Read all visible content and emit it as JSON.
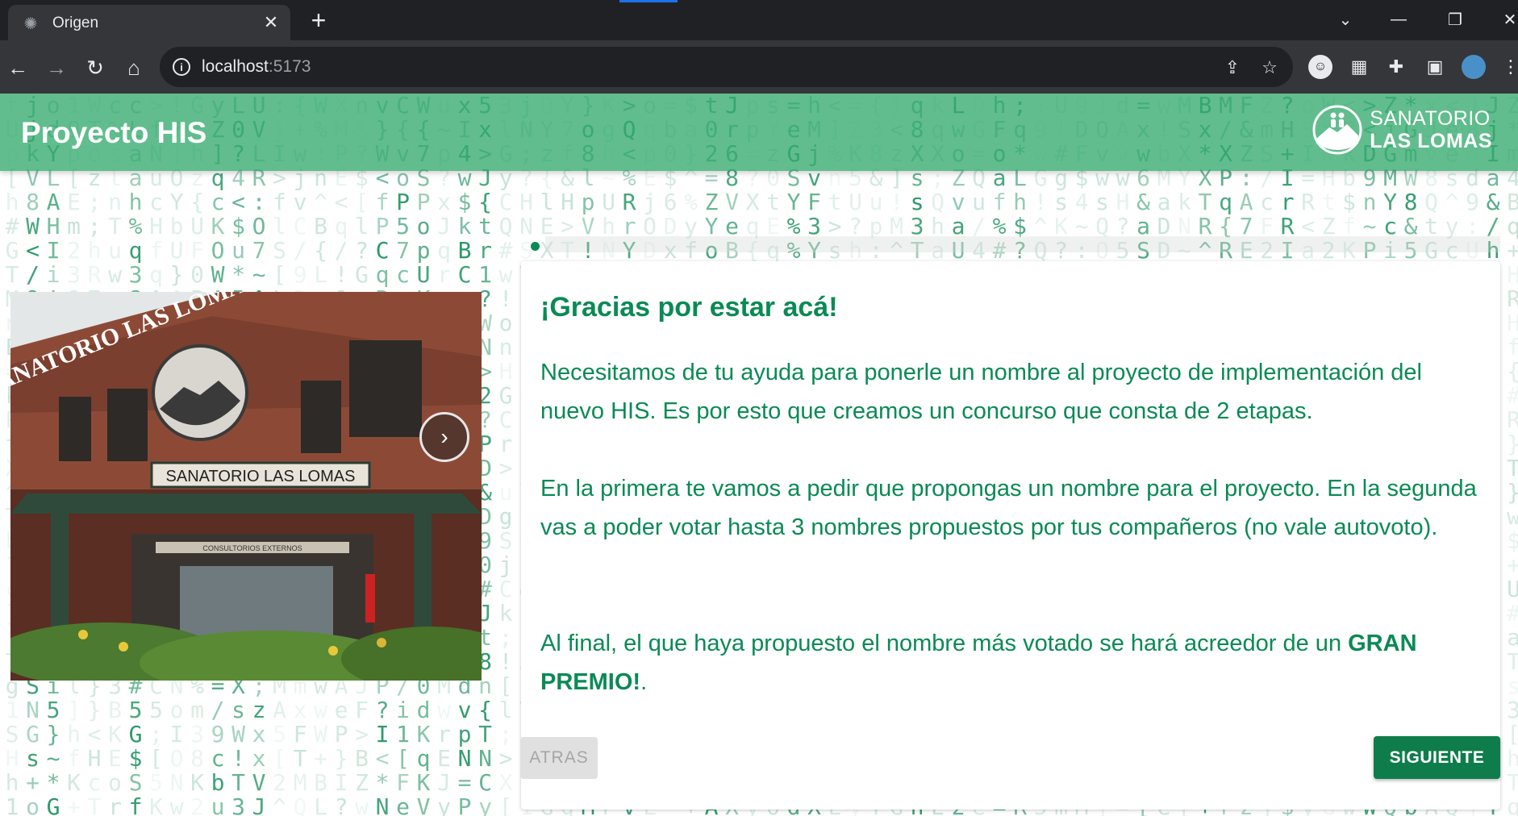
{
  "browser": {
    "tab_title": "Origen",
    "new_tab_label": "+",
    "url_host": "localhost",
    "url_port": ":5173"
  },
  "page": {
    "app_title": "Proyecto HIS",
    "brand": {
      "line1": "SANATORIO",
      "line2": "LAS LOMAS"
    },
    "card": {
      "title": "¡Gracias por estar acá!",
      "paragraph1": "Necesitamos de tu ayuda para ponerle un nombre al proyecto de implementación del nuevo HIS. Es por esto que creamos un concurso que consta de 2 etapas.",
      "paragraph2": "En la primera te vamos a pedir que propongas un nombre para el proyecto. En la segunda vas a poder votar hasta 3 nombres propuestos por tus compañeros (no vale autovoto).",
      "paragraph3_text": "Al final, el que haya propuesto el nombre más votado se hará acreedor de un ",
      "paragraph3_bold": "GRAN PREMIO!",
      "paragraph3_end": "."
    },
    "photo": {
      "arch_sign": "SANATORIO LAS LOMAS",
      "facade_sign": "SANATORIO LAS LOMAS",
      "door_sign": "CONSULTORIOS EXTERNOS"
    },
    "buttons": {
      "back": "ATRAS",
      "next": "SIGUIENTE"
    }
  },
  "colors": {
    "accent_green": "#0a8a55",
    "header_green": "#34aa6e",
    "next_button": "#0e7d4b"
  }
}
